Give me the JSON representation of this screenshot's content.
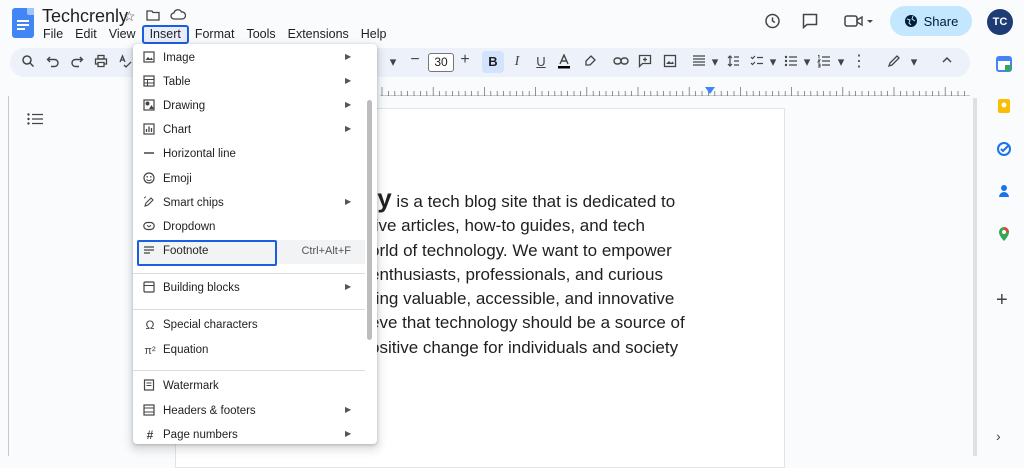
{
  "app": {
    "title": "Techcrenly",
    "menus": [
      "File",
      "Edit",
      "View",
      "Insert",
      "Format",
      "Tools",
      "Extensions",
      "Help"
    ],
    "active_menu": "Insert",
    "share_label": "Share",
    "avatar_initials": "TC",
    "accent": "#1a5fe0"
  },
  "toolbar": {
    "font_size": "30"
  },
  "insert_menu": {
    "items": [
      {
        "label": "Image",
        "icon": "image-icon",
        "submenu": true
      },
      {
        "label": "Table",
        "icon": "table-icon",
        "submenu": true
      },
      {
        "label": "Drawing",
        "icon": "drawing-icon",
        "submenu": true
      },
      {
        "label": "Chart",
        "icon": "chart-icon",
        "submenu": true
      },
      {
        "label": "Horizontal line",
        "icon": "horizontal-line-icon",
        "submenu": false
      },
      {
        "label": "Emoji",
        "icon": "emoji-icon",
        "submenu": false
      },
      {
        "label": "Smart chips",
        "icon": "smart-chips-icon",
        "submenu": true
      },
      {
        "label": "Dropdown",
        "icon": "dropdown-icon",
        "submenu": false
      },
      {
        "label": "Footnote",
        "icon": "footnote-icon",
        "submenu": false,
        "shortcut": "Ctrl+Alt+F"
      },
      {
        "label": "Building blocks",
        "icon": "building-blocks-icon",
        "submenu": true
      },
      {
        "label": "Special characters",
        "icon": "omega-icon",
        "submenu": false
      },
      {
        "label": "Equation",
        "icon": "pi-icon",
        "submenu": false
      },
      {
        "label": "Watermark",
        "icon": "watermark-icon",
        "submenu": false
      },
      {
        "label": "Headers & footers",
        "icon": "headers-footers-icon",
        "submenu": true
      },
      {
        "label": "Page numbers",
        "icon": "page-numbers-icon",
        "submenu": true
      }
    ]
  },
  "document": {
    "lead": "ly",
    "lines": [
      " is a tech blog site that is dedicated to",
      "tive articles, how-to guides, and tech",
      "orld of technology. We want to empower",
      "enthusiasts, professionals, and curious",
      "ring valuable, accessible, and innovative",
      "eve that technology should be a source of",
      "ositive change for individuals and society"
    ]
  }
}
